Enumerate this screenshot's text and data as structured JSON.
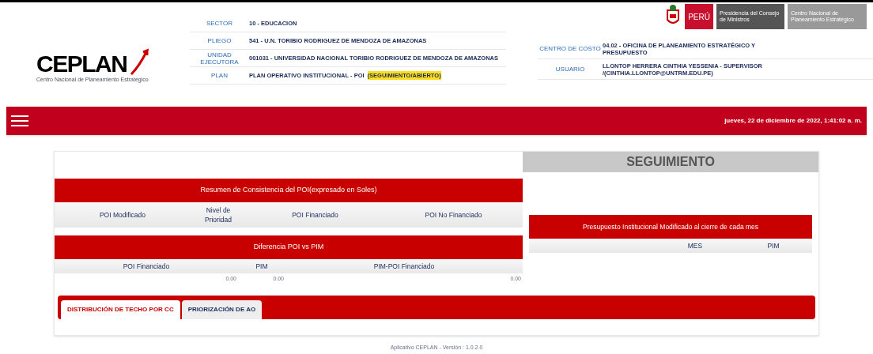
{
  "logo": {
    "name": "CEPLAN",
    "tagline": "Centro Nacional de Planeamiento Estratégico"
  },
  "gov_badge": {
    "country": "PERÚ",
    "entity": "Presidencia del Consejo de Ministros",
    "agency": "Centro Nacional de Planeamiento Estratégico"
  },
  "header_fields": [
    {
      "label": "SECTOR",
      "value": "10 - EDUCACION"
    },
    {
      "label": "PLIEGO",
      "value": "541 - U.N. TORIBIO RODRIGUEZ DE MENDOZA DE AMAZONAS"
    },
    {
      "label": "UNIDAD EJECUTORA",
      "value": "001031 - UNIVERSIDAD NACIONAL TORIBIO RODRIGUEZ DE MENDOZA DE AMAZONAS"
    },
    {
      "label": "PLAN",
      "value": "PLAN OPERATIVO INSTITUCIONAL - POI",
      "highlight": "(SEGUIMIENTO/ABIERTO)"
    }
  ],
  "right_fields": [
    {
      "label": "CENTRO DE COSTO",
      "value": "04.02 - OFICINA DE PLANEAMIENTO ESTRATÉGICO Y PRESUPUESTO"
    },
    {
      "label": "USUARIO",
      "value": "LLONTOP HERRERA CINTHIA YESSENIA - SUPERVISOR /(CINTHIA.LLONTOP@UNTRM.EDU.PE)"
    }
  ],
  "nav_bar": {
    "datetime": "jueves, 22 de diciembre de 2022, 1:41:02 a. m."
  },
  "summary_table": {
    "title": "Resumen de Consistencia del POI(expresado en Soles)",
    "columns": [
      "POI Modificado",
      "Nivel de Prioridad",
      "POI Financiado",
      "POI No Financiado"
    ]
  },
  "difference_table": {
    "title": "Diferencia POI vs PIM",
    "columns": [
      "POI Financiado",
      "PIM",
      "PIM-POI Financiado"
    ],
    "rows": [
      [
        "0.00",
        "0.00",
        "0.00"
      ]
    ]
  },
  "tracking": {
    "title": "SEGUIMIENTO",
    "table": {
      "title": "Presupuesto Institucional Modificado al cierre de cada mes",
      "columns": [
        "MES",
        "PIM"
      ]
    }
  },
  "tabs": [
    {
      "label": "DISTRIBUCIÓN DE TECHO POR CC",
      "selected": true
    },
    {
      "label": "PRIORIZACIÓN DE AO",
      "selected": false
    }
  ],
  "footer": "Aplicativo CEPLAN - Versión : 1.0.2.0"
}
